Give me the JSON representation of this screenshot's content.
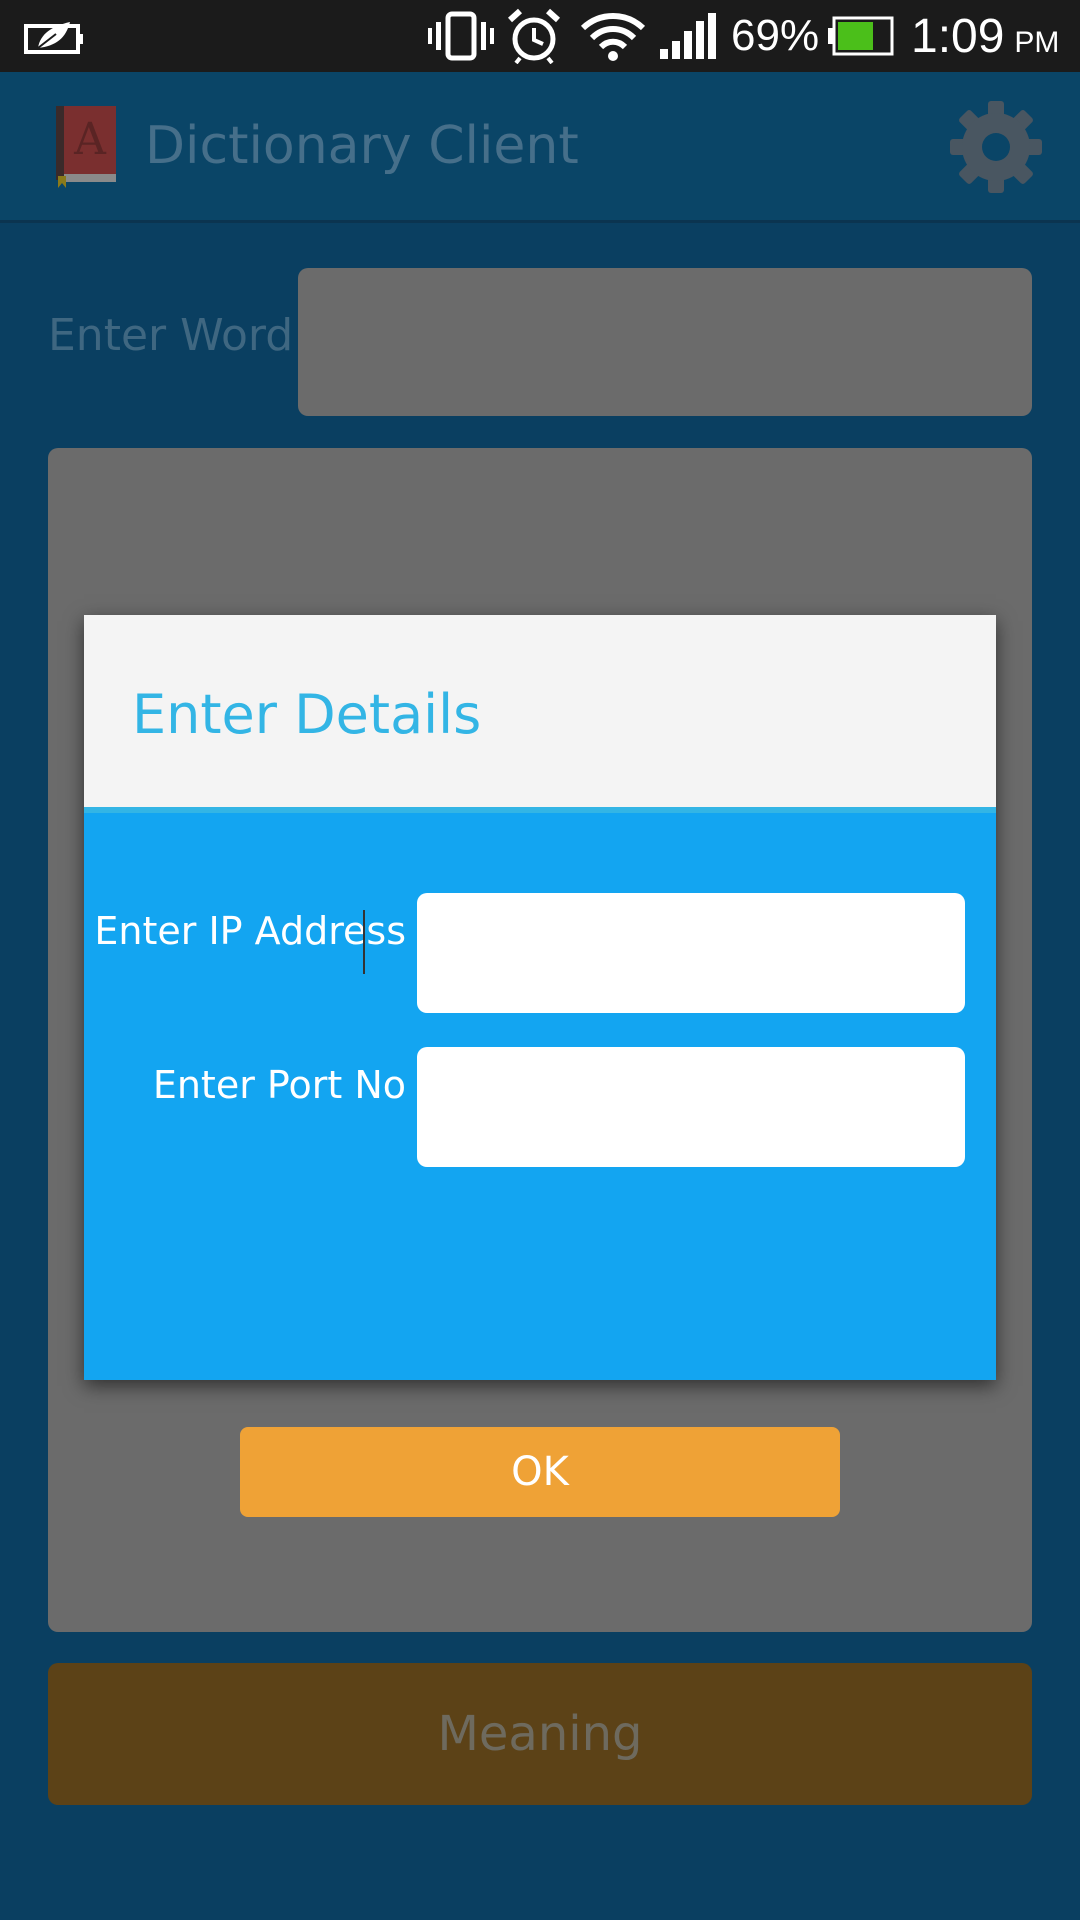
{
  "status_bar": {
    "battery_percent": "69%",
    "battery_level": 0.69,
    "time": "1:09",
    "ampm": "PM",
    "icons": [
      "leaf-battery-saver-icon",
      "vibrate-icon",
      "alarm-icon",
      "wifi-icon",
      "signal-icon",
      "battery-icon"
    ]
  },
  "app_bar": {
    "title": "Dictionary Client",
    "app_icon": "dictionary-book-icon",
    "settings_icon": "gear-icon"
  },
  "main": {
    "word_label": "Enter Word :",
    "word_value": "",
    "result_text": "",
    "meaning_button": "Meaning"
  },
  "dialog": {
    "title": "Enter Details",
    "ip_label": "Enter IP Address",
    "ip_value": "",
    "port_label": "Enter Port No",
    "port_value": "",
    "ok_button": "OK"
  },
  "colors": {
    "dialog_accent": "#33b5e5",
    "dialog_body": "#13a5f1",
    "ok_button": "#efa236"
  }
}
